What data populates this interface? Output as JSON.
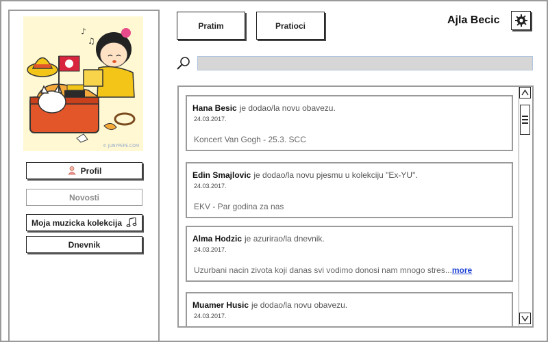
{
  "header": {
    "tabs": [
      {
        "label": "Pratim"
      },
      {
        "label": "Pratioci"
      }
    ],
    "user_name": "Ajla Becic",
    "settings_icon": "gear-icon"
  },
  "sidebar": {
    "avatar_credit": "© JUNYPEPE.COM",
    "items": [
      {
        "label": "Profil",
        "icon": "person-icon",
        "enabled": true
      },
      {
        "label": "Novosti",
        "enabled": false
      },
      {
        "label": "Moja muzicka kolekcija",
        "icon": "music-note-icon",
        "enabled": true
      },
      {
        "label": "Dnevnik",
        "enabled": true
      }
    ]
  },
  "search": {
    "value": "",
    "placeholder": "",
    "icon": "search-icon"
  },
  "feed": {
    "posts": [
      {
        "author": "Hana Besic",
        "action": "je dodao/la novu obavezu.",
        "date": "24.03.2017.",
        "content": "Koncert Van Gogh - 25.3. SCC",
        "more": ""
      },
      {
        "author": "Edin Smajlovic",
        "action": "je dodao/la novu pjesmu u kolekciju \"Ex-YU\".",
        "date": "24.03.2017.",
        "content": "EKV - Par godina za nas",
        "more": ""
      },
      {
        "author": "Alma Hodzic",
        "action": "je azurirao/la dnevnik.",
        "date": "24.03.2017.",
        "content": "Uzurbani nacin zivota koji danas svi vodimo donosi nam mnogo stres...",
        "more": "more"
      },
      {
        "author": "Muamer Husic",
        "action": "je dodao/la novu obavezu.",
        "date": "24.03.2017.",
        "content": "",
        "more": ""
      }
    ]
  },
  "colors": {
    "border": "#9a9a9a",
    "search_bg": "#d6d6d6",
    "link": "#1a3fd1",
    "avatar_bg": "#fff7cc"
  }
}
